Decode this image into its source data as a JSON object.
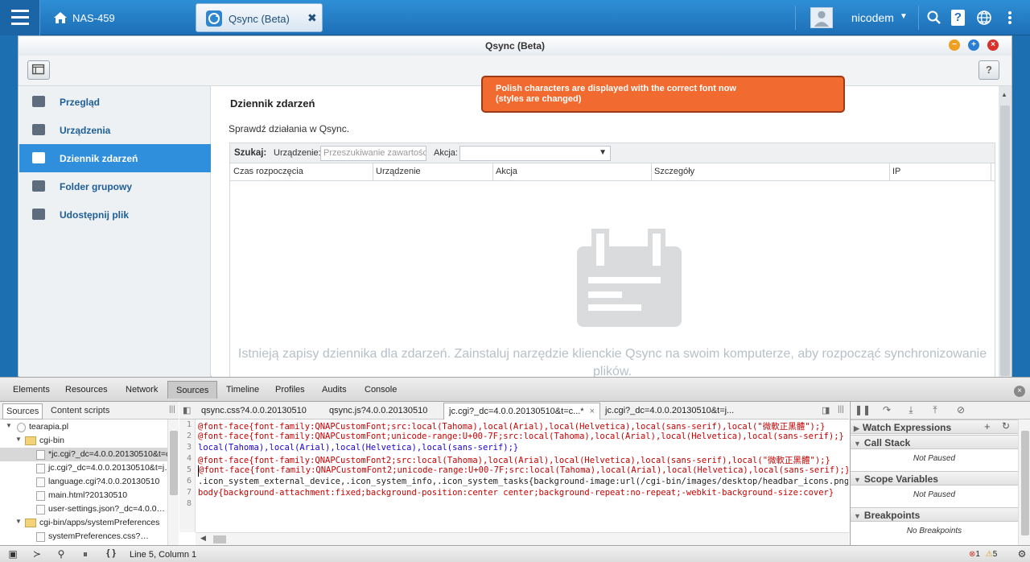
{
  "topbar": {
    "nas_name": "NAS-459",
    "app_tab": "Qsync (Beta)",
    "app_tab_close": "✖",
    "username": "nicodem",
    "user_caret": "▼"
  },
  "window": {
    "title": "Qsync (Beta)",
    "help": "?",
    "minimize": "−",
    "maximize": "+",
    "close": "×"
  },
  "sidebar": {
    "items": [
      {
        "label": "Przegląd",
        "icon": "grid-icon"
      },
      {
        "label": "Urządzenia",
        "icon": "device-icon"
      },
      {
        "label": "Dziennik zdarzeń",
        "icon": "calendar-icon",
        "active": true
      },
      {
        "label": "Folder grupowy",
        "icon": "group-icon"
      },
      {
        "label": "Udostępnij plik",
        "icon": "share-icon"
      }
    ]
  },
  "main": {
    "title": "Dziennik zdarzeń",
    "description": "Sprawdź działania w Qsync.",
    "search": {
      "label": "Szukaj:",
      "device_label": "Urządzenie:",
      "device_placeholder": "Przeszukiwanie zawartości",
      "action_label": "Akcja:",
      "action_value": ""
    },
    "columns": [
      "Czas rozpoczęcia",
      "Urządzenie",
      "Akcja",
      "Szczegóły",
      "IP"
    ],
    "empty_text": "Istnieją zapisy dziennika dla zdarzeń. Zainstaluj narzędzie klienckie Qsync na swoim komputerze, aby rozpocząć synchronizowanie plików."
  },
  "notice": {
    "line1": "Polish characters are displayed with the correct font now",
    "line2": "(styles are changed)",
    "color": "#f16a2f"
  },
  "devtools": {
    "tabs": [
      "Elements",
      "Resources",
      "Network",
      "Sources",
      "Timeline",
      "Profiles",
      "Audits",
      "Console"
    ],
    "active_tab": "Sources",
    "nav_tabs": [
      "Sources",
      "Content scripts"
    ],
    "tree": [
      {
        "label": "tearapia.pl",
        "type": "host"
      },
      {
        "label": "cgi-bin",
        "type": "folder"
      },
      {
        "label": "*jc.cgi?_dc=4.0.0.20130510&t=c…",
        "type": "file",
        "selected": true
      },
      {
        "label": "jc.cgi?_dc=4.0.0.20130510&t=j…",
        "type": "file"
      },
      {
        "label": "language.cgi?4.0.0.20130510",
        "type": "file"
      },
      {
        "label": "main.html?20130510",
        "type": "file"
      },
      {
        "label": "user-settings.json?_dc=4.0.0…",
        "type": "file"
      },
      {
        "label": "cgi-bin/apps/systemPreferences",
        "type": "folder"
      },
      {
        "label": "systemPreferences.css?…",
        "type": "file"
      }
    ],
    "editor_tabs": [
      "qsync.css?4.0.0.20130510",
      "qsync.js?4.0.0.20130510",
      "jc.cgi?_dc=4.0.0.20130510&t=c...*",
      "jc.cgi?_dc=4.0.0.20130510&t=j..."
    ],
    "editor_close": "×",
    "code": [
      "@font-face{font-family:QNAPCustomFont;src:local(Tahoma),local(Arial),local(Helvetica),local(sans-serif),local(\"微軟正黑體\");}",
      "@font-face{font-family:QNAPCustomFont;unicode-range:U+00-7F;src:local(Tahoma),local(Arial),local(Helvetica),local(sans-serif);}",
      "local(Tahoma),local(Arial),local(Helvetica),local(sans-serif);}",
      "@font-face{font-family:QNAPCustomFont2;src:local(Tahoma),local(Arial),local(Helvetica),local(sans-serif),local(\"微軟正黑體\");}",
      "@font-face{font-family:QNAPCustomFont2;unicode-range:U+00-7F;src:local(Tahoma),local(Arial),local(Helvetica),local(sans-serif);}",
      ".icon_system_external_device,.icon_system_info,.icon_system_tasks{background-image:url(/cgi-bin/images/desktop/headbar_icons.png)}",
      "body{background-attachment:fixed;background-position:center center;background-repeat:no-repeat;-webkit-background-size:cover}",
      ""
    ],
    "line_numbers": [
      "1",
      "2",
      "3",
      "4",
      "5",
      "6",
      "7",
      "8"
    ],
    "sections": [
      {
        "label": "Watch Expressions",
        "content": ""
      },
      {
        "label": "Call Stack",
        "content": "Not Paused"
      },
      {
        "label": "Scope Variables",
        "content": "Not Paused"
      },
      {
        "label": "Breakpoints",
        "content": "No Breakpoints"
      }
    ],
    "cursor": "Line 5, Column 1",
    "errors": "1",
    "warnings": "5",
    "curly": "{ }"
  }
}
